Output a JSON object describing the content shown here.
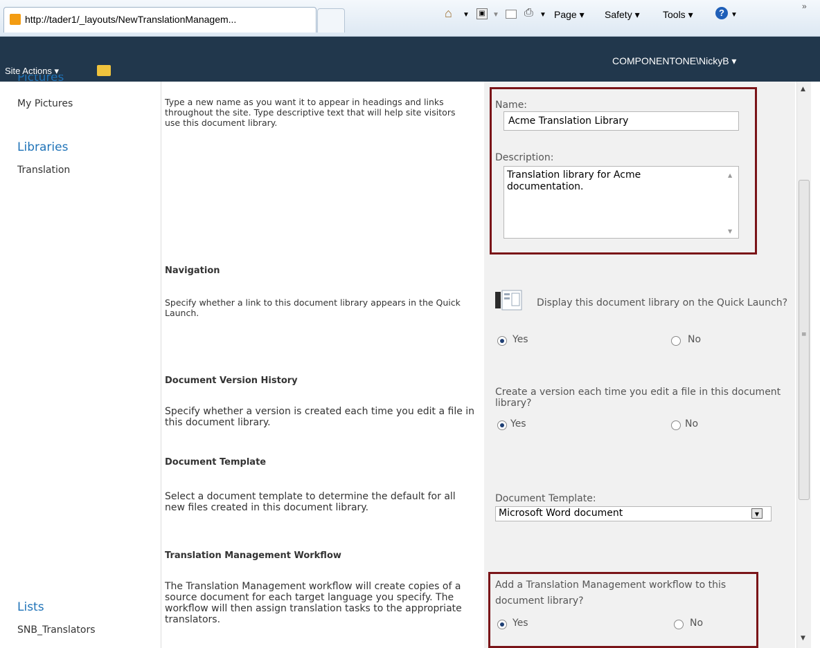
{
  "browser": {
    "address": "http://tader1/_layouts/NewTranslationManagem...",
    "toolbar": {
      "page": "Page ▾",
      "safety": "Safety ▾",
      "tools": "Tools ▾"
    }
  },
  "header": {
    "site_actions": "Site Actions ▾",
    "user": "COMPONENTONE\\NickyB ▾"
  },
  "leftnav": {
    "pictures_heading": "Pictures",
    "my_pictures": "My Pictures",
    "libraries_heading": "Libraries",
    "translation": "Translation",
    "lists_heading": "Lists",
    "snb_translators": "SNB_Translators"
  },
  "name_section": {
    "description": "Type a new name as you want it to appear in headings and links throughout the site. Type descriptive text that will help site visitors use this document library.",
    "name_label": "Name:",
    "name_value": "Acme Translation Library",
    "desc_label": "Description:",
    "desc_value": "Translation library for Acme documentation."
  },
  "navigation": {
    "title": "Navigation",
    "description": "Specify whether a link to this document library appears in the Quick Launch.",
    "question": "Display this document library on the Quick Launch?",
    "yes": "Yes",
    "no": "No",
    "selected": "Yes"
  },
  "version_history": {
    "title": "Document Version History",
    "description": "Specify whether a version is created each time you edit a file in this document library.",
    "question": "Create a version each time you edit a file in this document library?",
    "yes": "Yes",
    "no": "No",
    "selected": "Yes"
  },
  "template": {
    "title": "Document Template",
    "description": "Select a document template to determine the default for all new files created in this document library.",
    "label": "Document Template:",
    "selected": "Microsoft Word document"
  },
  "workflow": {
    "title": "Translation Management Workflow",
    "description": "The Translation Management workflow will create copies of a source document for each target language you specify. The workflow will then assign translation tasks to the appropriate translators.",
    "question": "Add a Translation Management workflow to this document library?",
    "yes": "Yes",
    "no": "No",
    "selected": "Yes"
  },
  "colors": {
    "header_bg": "#21374c",
    "link_blue": "#1f73b8",
    "highlight_border": "#7a1418"
  }
}
